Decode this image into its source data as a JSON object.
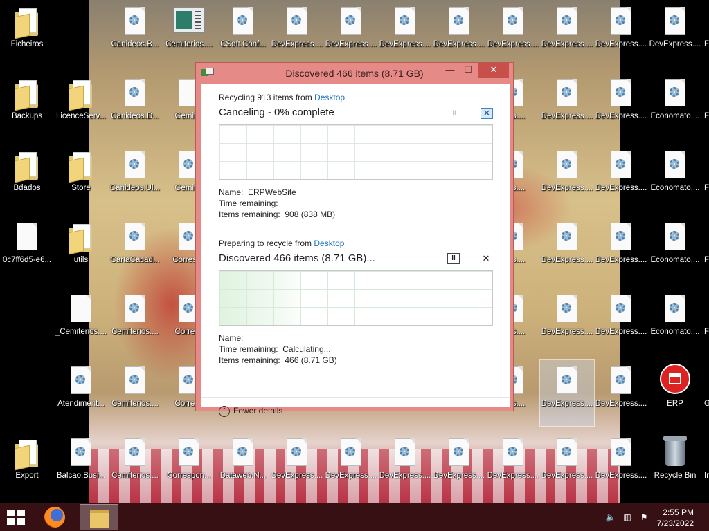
{
  "desktop": {
    "icons": [
      {
        "label": "Ficheiros",
        "type": "folder"
      },
      {
        "label": "Canideos.B...",
        "type": "config"
      },
      {
        "label": "Cemiterios....",
        "type": "app"
      },
      {
        "label": "CSoft.Conf...",
        "type": "config"
      },
      {
        "label": "DevExpress....",
        "type": "config"
      },
      {
        "label": "DevExpress....",
        "type": "config"
      },
      {
        "label": "DevExpress....",
        "type": "config"
      },
      {
        "label": "DevExpress....",
        "type": "config"
      },
      {
        "label": "DevExpress....",
        "type": "config"
      },
      {
        "label": "DevExpress....",
        "type": "config"
      },
      {
        "label": "DevExpress....",
        "type": "config"
      },
      {
        "label": "DevExpress....",
        "type": "config"
      },
      {
        "label": "Backups",
        "type": "folder"
      },
      {
        "label": "LicenceServ...",
        "type": "folder"
      },
      {
        "label": "Canideos.D...",
        "type": "config"
      },
      {
        "label": "Gemiter",
        "type": "file"
      },
      {
        "label": "ress....",
        "type": "config"
      },
      {
        "label": "DevExpress....",
        "type": "config"
      },
      {
        "label": "DevExpress....",
        "type": "config"
      },
      {
        "label": "Economato....",
        "type": "config"
      },
      {
        "label": "Bdados",
        "type": "folder"
      },
      {
        "label": "Store",
        "type": "folder"
      },
      {
        "label": "Canideos.Ul...",
        "type": "config"
      },
      {
        "label": "Gemiter",
        "type": "config"
      },
      {
        "label": "ress....",
        "type": "config"
      },
      {
        "label": "DevExpress....",
        "type": "config"
      },
      {
        "label": "DevExpress....",
        "type": "config"
      },
      {
        "label": "Economato....",
        "type": "config"
      },
      {
        "label": "0c7ff6d5-e6...",
        "type": "file"
      },
      {
        "label": "utils",
        "type": "folder"
      },
      {
        "label": "CartaCacad...",
        "type": "config"
      },
      {
        "label": "Correspo",
        "type": "config"
      },
      {
        "label": "ress....",
        "type": "config"
      },
      {
        "label": "DevExpress....",
        "type": "config"
      },
      {
        "label": "DevExpress....",
        "type": "config"
      },
      {
        "label": "Economato....",
        "type": "config"
      },
      {
        "label": "_Cemiterios....",
        "type": "file"
      },
      {
        "label": "Cemiterios....",
        "type": "config"
      },
      {
        "label": "Corresp",
        "type": "config"
      },
      {
        "label": "ress....",
        "type": "config"
      },
      {
        "label": "DevExpress....",
        "type": "config"
      },
      {
        "label": "DevExpress....",
        "type": "config"
      },
      {
        "label": "Economato....",
        "type": "config"
      },
      {
        "label": "Atendiment...",
        "type": "config"
      },
      {
        "label": "Cemiterios....",
        "type": "config"
      },
      {
        "label": "Corresp",
        "type": "config"
      },
      {
        "label": "ress....",
        "type": "config"
      },
      {
        "label": "DevExpress....",
        "type": "config"
      },
      {
        "label": "DevExpress....",
        "type": "config"
      },
      {
        "label": "ERP",
        "type": "erp"
      },
      {
        "label": "Export",
        "type": "folder"
      },
      {
        "label": "Balcao.Busi...",
        "type": "config"
      },
      {
        "label": "Cemiterios....",
        "type": "config"
      },
      {
        "label": "Correspon...",
        "type": "config"
      },
      {
        "label": "Dataweb.N...",
        "type": "config"
      },
      {
        "label": "DevExpress....",
        "type": "config"
      },
      {
        "label": "DevExpress....",
        "type": "config"
      },
      {
        "label": "DevExpress....",
        "type": "config"
      },
      {
        "label": "DevExpress....",
        "type": "config"
      },
      {
        "label": "DevExpress....",
        "type": "config"
      },
      {
        "label": "DevExpress....",
        "type": "config"
      },
      {
        "label": "DevExpress....",
        "type": "config"
      },
      {
        "label": "Recycle Bin",
        "type": "bin"
      }
    ],
    "edge_labels": [
      "F",
      "F",
      "F",
      "F",
      "F",
      "G",
      "Ir"
    ]
  },
  "dialog": {
    "title": "Discovered 466 items (8.71 GB)",
    "buttons": {
      "minimize": "—",
      "maximize": "☐",
      "close": "✕"
    },
    "op1": {
      "header_prefix": "Recycling 913 items from ",
      "header_link": "Desktop",
      "status": "Canceling - 0% complete",
      "progress_percent": 0,
      "pause_glyph": "II",
      "cancel_glyph": "✕",
      "name_label": "Name:",
      "name_value": "ERPWebSite",
      "time_label": "Time remaining:",
      "time_value": "",
      "items_label": "Items remaining:",
      "items_value": "908 (838 MB)"
    },
    "op2": {
      "header_prefix": "Preparing to recycle from ",
      "header_link": "Desktop",
      "status": "Discovered 466 items (8.71 GB)...",
      "pause_glyph": "II",
      "cancel_glyph": "✕",
      "name_label": "Name:",
      "name_value": "",
      "time_label": "Time remaining:",
      "time_value": "Calculating...",
      "items_label": "Items remaining:",
      "items_value": "466 (8.71 GB)"
    },
    "fewer_details": "Fewer details",
    "fewer_glyph": "⌃"
  },
  "taskbar": {
    "clock_time": "2:55 PM",
    "clock_date": "7/23/2022",
    "tray": {
      "volume": "🔈",
      "network": "▥",
      "flag": "⚑"
    }
  },
  "colors": {
    "dialog_frame": "#e58a86",
    "close_button": "#c7504b",
    "link": "#1e73be",
    "taskbar": "#46141a"
  }
}
